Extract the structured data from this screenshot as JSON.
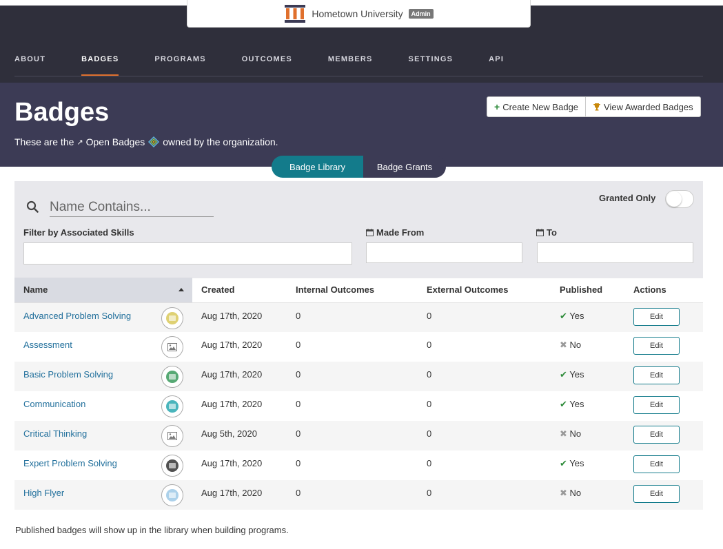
{
  "org": {
    "name": "Hometown University",
    "role_badge": "Admin"
  },
  "nav": [
    {
      "label": "ABOUT",
      "active": false
    },
    {
      "label": "BADGES",
      "active": true
    },
    {
      "label": "PROGRAMS",
      "active": false
    },
    {
      "label": "OUTCOMES",
      "active": false
    },
    {
      "label": "MEMBERS",
      "active": false
    },
    {
      "label": "SETTINGS",
      "active": false
    },
    {
      "label": "API",
      "active": false
    }
  ],
  "hero": {
    "title": "Badges",
    "subtitle_prefix": "These are the",
    "subtitle_link": "Open Badges",
    "subtitle_suffix": "owned by the organization.",
    "create_label": "Create New Badge",
    "view_label": "View Awarded Badges"
  },
  "segments": {
    "library": "Badge Library",
    "grants": "Badge Grants"
  },
  "filters": {
    "search_placeholder": "Name Contains...",
    "granted_only": "Granted Only",
    "skills_label": "Filter by Associated Skills",
    "made_from_label": "Made From",
    "to_label": "To"
  },
  "table": {
    "headers": {
      "name": "Name",
      "created": "Created",
      "internal": "Internal Outcomes",
      "external": "External Outcomes",
      "published": "Published",
      "actions": "Actions"
    },
    "edit_label": "Edit",
    "rows": [
      {
        "name": "Advanced Problem Solving",
        "created": "Aug 17th, 2020",
        "internal": "0",
        "external": "0",
        "published": "Yes",
        "thumb_color": "#d9c95a"
      },
      {
        "name": "Assessment",
        "created": "Aug 17th, 2020",
        "internal": "0",
        "external": "0",
        "published": "No",
        "thumb_color": "placeholder"
      },
      {
        "name": "Basic Problem Solving",
        "created": "Aug 17th, 2020",
        "internal": "0",
        "external": "0",
        "published": "Yes",
        "thumb_color": "#3a9a5c"
      },
      {
        "name": "Communication",
        "created": "Aug 17th, 2020",
        "internal": "0",
        "external": "0",
        "published": "Yes",
        "thumb_color": "#2aa8b0"
      },
      {
        "name": "Critical Thinking",
        "created": "Aug 5th, 2020",
        "internal": "0",
        "external": "0",
        "published": "No",
        "thumb_color": "placeholder"
      },
      {
        "name": "Expert Problem Solving",
        "created": "Aug 17th, 2020",
        "internal": "0",
        "external": "0",
        "published": "Yes",
        "thumb_color": "#333333"
      },
      {
        "name": "High Flyer",
        "created": "Aug 17th, 2020",
        "internal": "0",
        "external": "0",
        "published": "No",
        "thumb_color": "#9ec9e6"
      }
    ]
  },
  "footnote": "Published badges will show up in the library when building programs."
}
